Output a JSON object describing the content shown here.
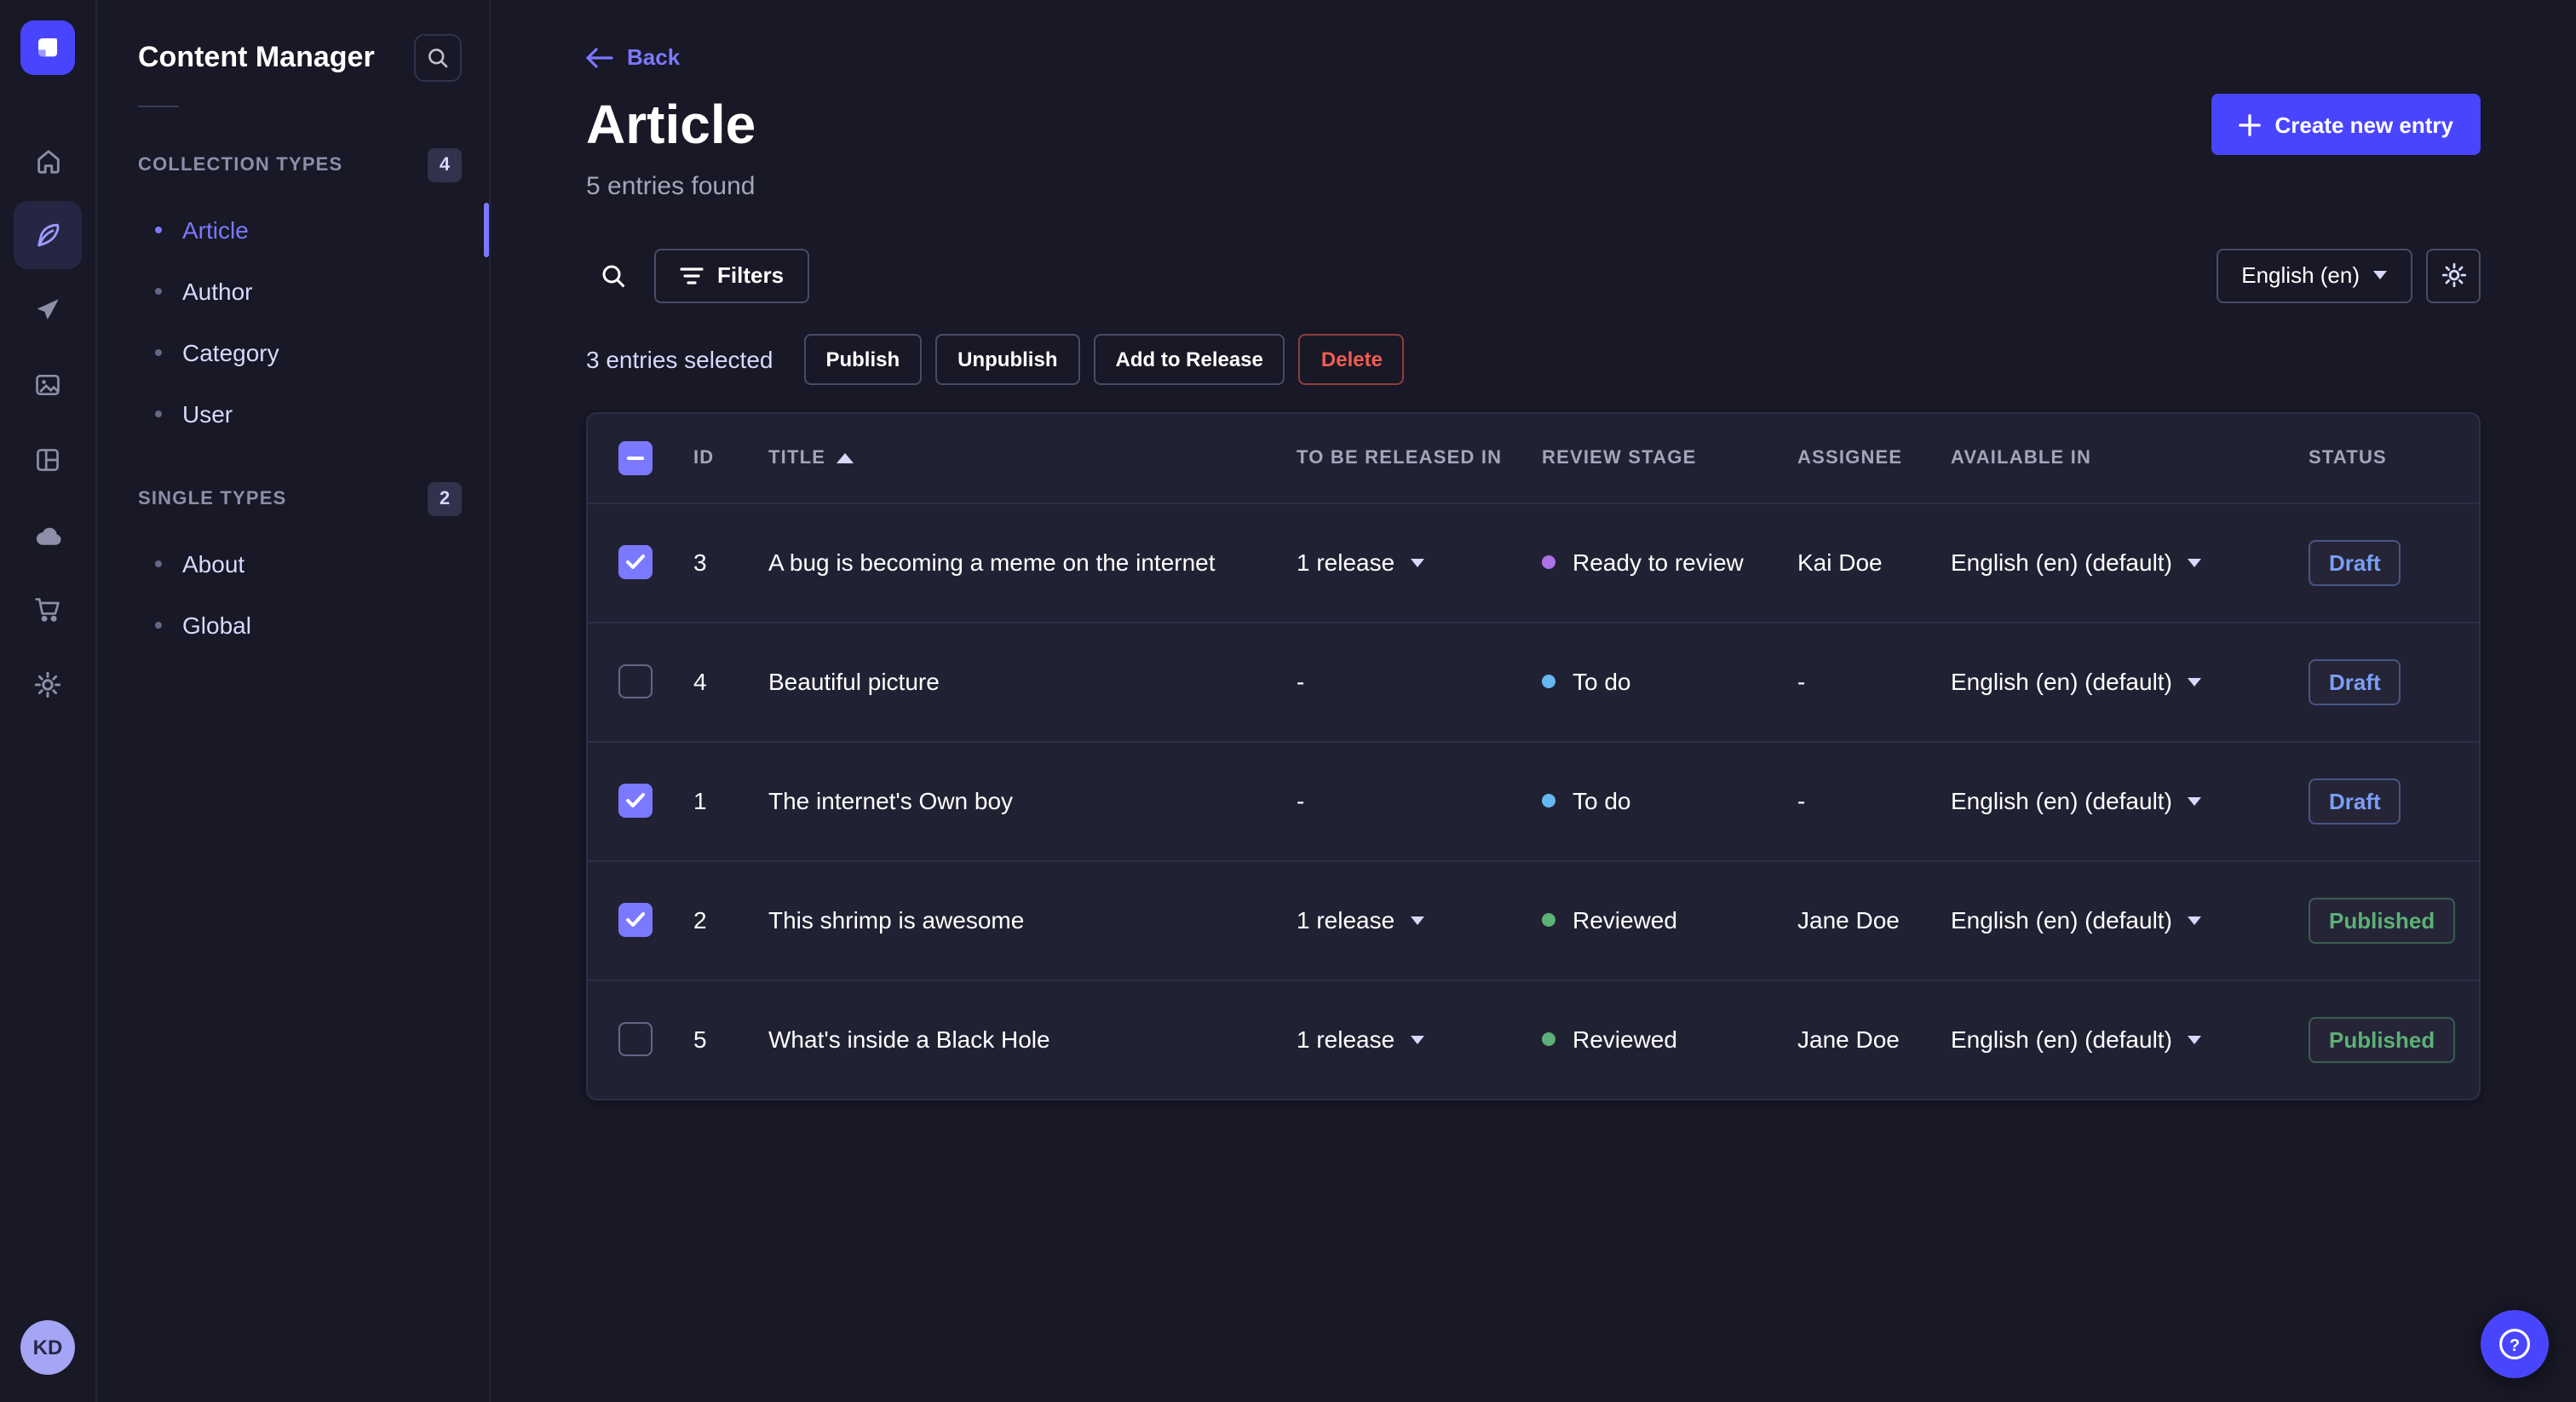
{
  "left_nav": {
    "icons": [
      "strapi-logo",
      "home",
      "content-manager",
      "release",
      "media-library",
      "content-type-builder",
      "deploy",
      "marketplace",
      "settings"
    ],
    "active_icon": "content-manager",
    "avatar_initials": "KD"
  },
  "sidebar": {
    "title": "Content Manager",
    "sections": [
      {
        "label": "COLLECTION TYPES",
        "badge": "4",
        "items": [
          {
            "label": "Article",
            "active": true
          },
          {
            "label": "Author",
            "active": false
          },
          {
            "label": "Category",
            "active": false
          },
          {
            "label": "User",
            "active": false
          }
        ]
      },
      {
        "label": "SINGLE TYPES",
        "badge": "2",
        "items": [
          {
            "label": "About",
            "active": false
          },
          {
            "label": "Global",
            "active": false
          }
        ]
      }
    ]
  },
  "header": {
    "back_label": "Back",
    "title": "Article",
    "subtitle": "5 entries found",
    "create_button": "Create new entry"
  },
  "toolbar": {
    "filters_label": "Filters",
    "locale_select": "English (en)"
  },
  "selection": {
    "count_label": "3 entries selected",
    "actions": [
      "Publish",
      "Unpublish",
      "Add to Release",
      "Delete"
    ]
  },
  "table": {
    "columns": [
      "ID",
      "TITLE",
      "TO BE RELEASED IN",
      "REVIEW STAGE",
      "ASSIGNEE",
      "AVAILABLE IN",
      "STATUS"
    ],
    "sorted_column": "TITLE",
    "header_checkbox_state": "indeterminate",
    "rows": [
      {
        "checked": true,
        "id": "3",
        "title": "A bug is becoming a meme on the internet",
        "release": "1 release",
        "review_stage": "Ready to review",
        "review_color": "#ac73e6",
        "assignee": "Kai Doe",
        "available_in": "English (en) (default)",
        "status": "Draft",
        "status_color": "#7b9ff5"
      },
      {
        "checked": false,
        "id": "4",
        "title": "Beautiful picture",
        "release": "-",
        "review_stage": "To do",
        "review_color": "#66b7f1",
        "assignee": "-",
        "available_in": "English (en) (default)",
        "status": "Draft",
        "status_color": "#7b9ff5"
      },
      {
        "checked": true,
        "id": "1",
        "title": "The internet's Own boy",
        "release": "-",
        "review_stage": "To do",
        "review_color": "#66b7f1",
        "assignee": "-",
        "available_in": "English (en) (default)",
        "status": "Draft",
        "status_color": "#7b9ff5"
      },
      {
        "checked": true,
        "id": "2",
        "title": "This shrimp is awesome",
        "release": "1 release",
        "review_stage": "Reviewed",
        "review_color": "#5cb176",
        "assignee": "Jane Doe",
        "available_in": "English (en) (default)",
        "status": "Published",
        "status_color": "#5cb176"
      },
      {
        "checked": false,
        "id": "5",
        "title": "What's inside a Black Hole",
        "release": "1 release",
        "review_stage": "Reviewed",
        "review_color": "#5cb176",
        "assignee": "Jane Doe",
        "available_in": "English (en) (default)",
        "status": "Published",
        "status_color": "#5cb176"
      }
    ]
  },
  "fab": {
    "label": "help"
  },
  "colors": {
    "primary": "#4945ff",
    "link": "#7b79ff",
    "background": "#181826",
    "surface": "#212134",
    "draft": "#7b9ff5",
    "published": "#5cb176",
    "danger": "#ee5e52"
  }
}
